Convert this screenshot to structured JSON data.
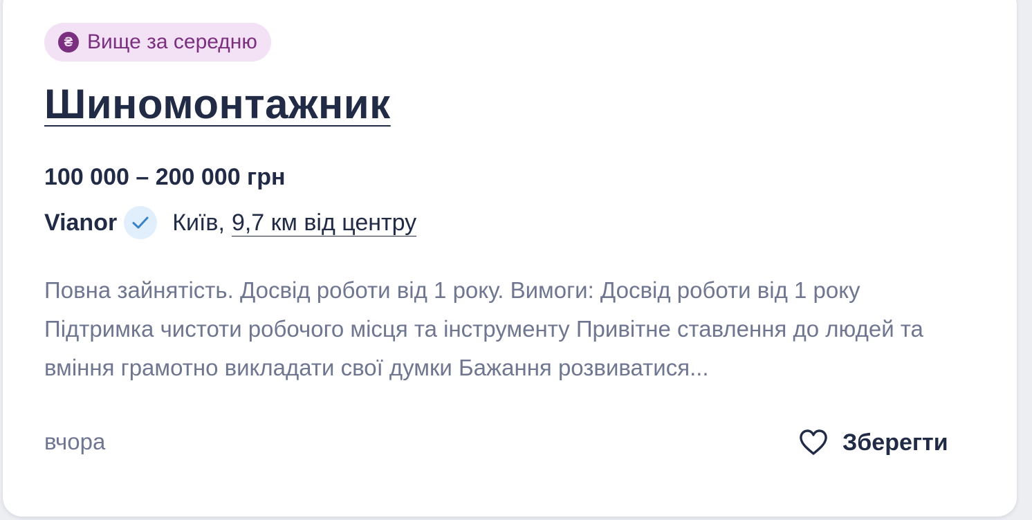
{
  "badge": {
    "icon": "hryvnia-sign-icon",
    "icon_glyph": "₴",
    "label": "Вище за середню"
  },
  "job": {
    "title": "Шиномонтажник",
    "salary": "100 000 – 200 000 грн"
  },
  "company": {
    "name": "Vianor",
    "verified_icon": "check-icon",
    "city": "Київ,",
    "distance": "9,7 км від центру"
  },
  "description": "Повна зайнятість. Досвід роботи від 1 року. Вимоги: Досвід роботи від 1 року Підтримка чистоти робочого місця та інструменту Привітне ставлення до людей та вміння грамотно викладати свої думки Бажання розвиватися...",
  "footer": {
    "posted": "вчора",
    "save_label": "Зберегти",
    "save_icon": "heart-icon"
  },
  "colors": {
    "text_primary": "#212b45",
    "text_secondary": "#6f7690",
    "badge_bg": "#f3e1f6",
    "badge_fg": "#7a2f7f",
    "verified_bg": "#e1eefb",
    "verified_fg": "#3a82c6"
  }
}
